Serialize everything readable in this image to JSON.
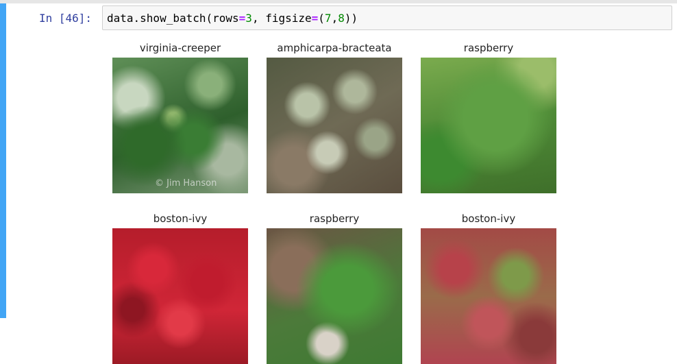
{
  "cell": {
    "prompt": "In [46]:",
    "code": {
      "call": "data.show_batch(",
      "arg1_name": "rows",
      "eq": "=",
      "arg1_value": "3",
      "sep": ", ",
      "arg2_name": "figsize",
      "arg2_value_open": "(",
      "arg2_value_a": "7",
      "arg2_comma": ",",
      "arg2_value_b": "8",
      "close": "))"
    }
  },
  "output": {
    "panels": [
      {
        "label": "virginia-creeper"
      },
      {
        "label": "amphicarpa-bracteata"
      },
      {
        "label": "raspberry"
      },
      {
        "label": "boston-ivy"
      },
      {
        "label": "raspberry"
      },
      {
        "label": "boston-ivy"
      }
    ],
    "watermark": "© Jim Hanson"
  },
  "colors": {
    "cell_selected_bar": "#42a5f5",
    "prompt": "#303f9f",
    "code_keyword_eq": "#aa22ff",
    "code_number": "#008800"
  }
}
